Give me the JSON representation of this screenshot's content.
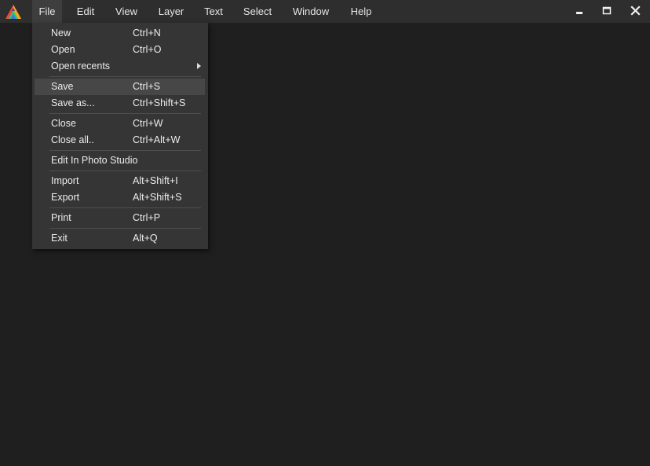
{
  "menubar": {
    "items": [
      {
        "label": "File"
      },
      {
        "label": "Edit"
      },
      {
        "label": "View"
      },
      {
        "label": "Layer"
      },
      {
        "label": "Text"
      },
      {
        "label": "Select"
      },
      {
        "label": "Window"
      },
      {
        "label": "Help"
      }
    ],
    "active_item": "File"
  },
  "window_controls": {
    "minimize_icon": "minimize-icon",
    "maximize_icon": "maximize-icon",
    "close_icon": "close-icon"
  },
  "logo": {
    "icon": "app-logo-triangle",
    "colors": [
      "#e84b3c",
      "#f5a623",
      "#2ecc71",
      "#3d7bd9"
    ]
  },
  "file_menu": {
    "items": [
      {
        "label": "New",
        "shortcut": "Ctrl+N"
      },
      {
        "label": "Open",
        "shortcut": "Ctrl+O"
      },
      {
        "label": "Open recents",
        "shortcut": "",
        "submenu": true
      },
      {
        "label": "Save",
        "shortcut": "Ctrl+S",
        "highlighted": true
      },
      {
        "label": "Save as...",
        "shortcut": "Ctrl+Shift+S"
      },
      {
        "label": "Close",
        "shortcut": "Ctrl+W"
      },
      {
        "label": "Close all..",
        "shortcut": "Ctrl+Alt+W"
      },
      {
        "label": "Edit In Photo Studio",
        "shortcut": ""
      },
      {
        "label": "Import",
        "shortcut": "Alt+Shift+I"
      },
      {
        "label": "Export",
        "shortcut": "Alt+Shift+S"
      },
      {
        "label": "Print",
        "shortcut": "Ctrl+P"
      },
      {
        "label": "Exit",
        "shortcut": "Alt+Q"
      }
    ]
  },
  "colors": {
    "background": "#1f1f1f",
    "menubar": "#2e2e2e",
    "dropdown": "#353535",
    "highlight": "#474747",
    "text": "#ececec"
  }
}
